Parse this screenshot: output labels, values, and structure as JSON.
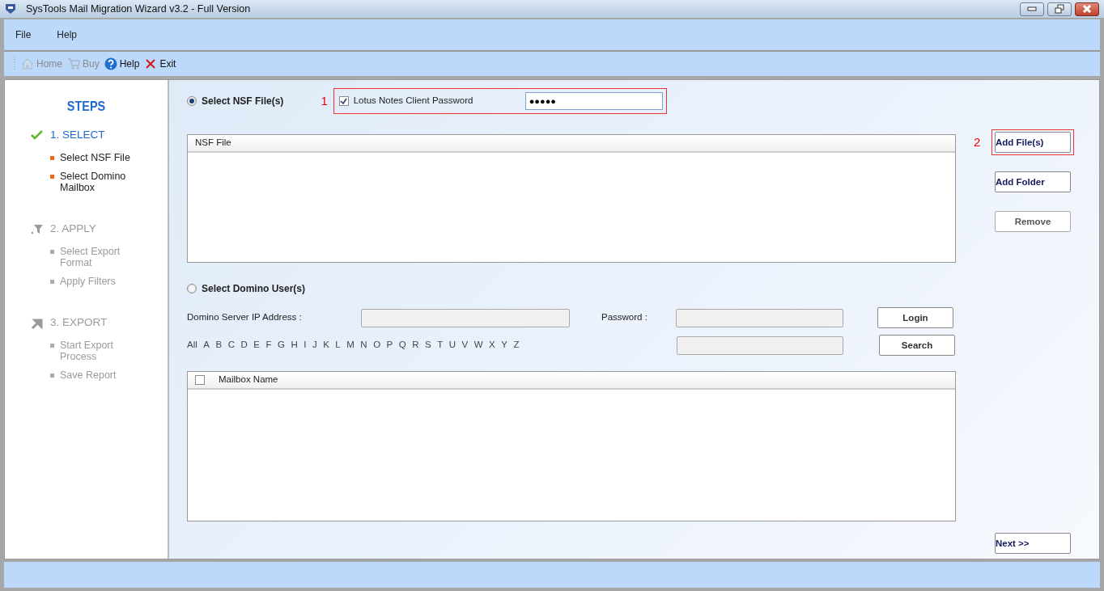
{
  "window": {
    "title": "SysTools Mail Migration Wizard v3.2 - Full Version"
  },
  "menu": [
    "File",
    "Help"
  ],
  "toolbar": [
    {
      "label": "Home",
      "disabled": true
    },
    {
      "label": "Buy",
      "disabled": true
    },
    {
      "label": "Help",
      "disabled": false
    },
    {
      "label": "Exit",
      "disabled": false
    }
  ],
  "sidebar": {
    "title": "STEPS",
    "steps": [
      {
        "label": "1. SELECT",
        "active": true,
        "items": [
          "Select NSF File",
          "Select Domino Mailbox"
        ]
      },
      {
        "label": "2. APPLY",
        "active": false,
        "items": [
          "Select Export Format",
          "Apply Filters"
        ]
      },
      {
        "label": "3. EXPORT",
        "active": false,
        "items": [
          "Start Export Process",
          "Save Report"
        ]
      }
    ]
  },
  "nsf_option": {
    "label": "Select NSF File(s)",
    "selected": true,
    "annotation": "1",
    "highlighted": true,
    "password_checkbox": {
      "label": "Lotus Notes Client Password",
      "checked": true
    },
    "password_value": "●●●●●"
  },
  "nsf_table": {
    "columns": [
      "NSF File"
    ]
  },
  "file_buttons": [
    {
      "label": "Add File(s)",
      "disabled": false,
      "annotation": "2",
      "highlighted": true
    },
    {
      "label": "Add Folder",
      "disabled": false,
      "highlighted": false
    },
    {
      "label": "Remove",
      "disabled": true,
      "highlighted": false
    }
  ],
  "domino_option": {
    "label": "Select Domino User(s)",
    "selected": false,
    "server_label": "Domino Server IP Address :",
    "password_label": "Password :",
    "login_button": "Login",
    "search_button": "Search",
    "letters": [
      "All",
      "A",
      "B",
      "C",
      "D",
      "E",
      "F",
      "G",
      "H",
      "I",
      "J",
      "K",
      "L",
      "M",
      "N",
      "O",
      "P",
      "Q",
      "R",
      "S",
      "T",
      "U",
      "V",
      "W",
      "X",
      "Y",
      "Z"
    ]
  },
  "mailbox_table": {
    "select_all_checked": false,
    "columns": [
      "Mailbox Name"
    ]
  },
  "next_button": "Next >>"
}
